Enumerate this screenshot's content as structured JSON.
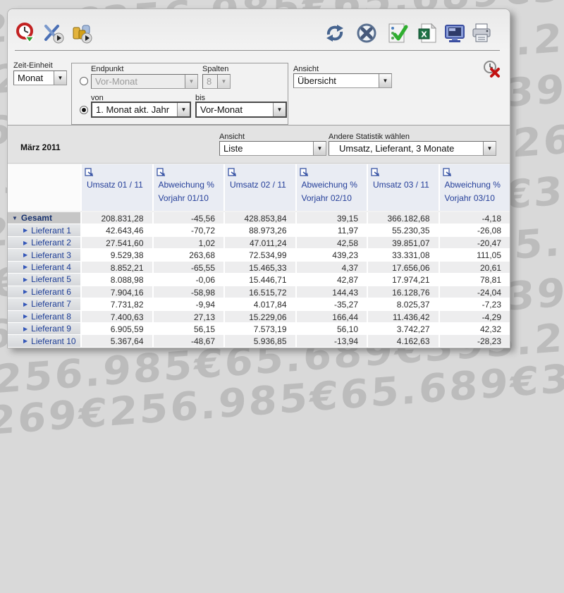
{
  "background": {
    "watermark_text": "395.269€256.985€65.689€"
  },
  "toolbar": {
    "left_icons": [
      {
        "name": "time-period-icon"
      },
      {
        "name": "analysis-tools-icon"
      },
      {
        "name": "data-stock-icon"
      }
    ],
    "right_icons": [
      {
        "name": "refresh-icon"
      },
      {
        "name": "cancel-icon"
      },
      {
        "name": "validate-list-icon"
      },
      {
        "name": "excel-export-icon"
      },
      {
        "name": "screen-view-icon"
      },
      {
        "name": "print-icon"
      }
    ]
  },
  "filter_panel": {
    "zeit_einheit": {
      "label": "Zeit-Einheit",
      "value": "Monat"
    },
    "endpunkt": {
      "label": "Endpunkt",
      "value": "Vor-Monat"
    },
    "spalten": {
      "label": "Spalten",
      "value": "8"
    },
    "von": {
      "label": "von",
      "value": "1. Monat akt. Jahr"
    },
    "bis": {
      "label": "bis",
      "value": "Vor-Monat"
    },
    "ansicht": {
      "label": "Ansicht",
      "value": "Übersicht"
    },
    "reset_icon": "clock-cancel-icon"
  },
  "status_row": {
    "period": "März 2011",
    "ansicht": {
      "label": "Ansicht",
      "value": "Liste"
    },
    "statistik": {
      "label": "Andere Statistik wählen",
      "value": "Umsatz, Lieferant, 3 Monate"
    }
  },
  "table": {
    "columns": [
      {
        "line1": "Umsatz 01 / 11",
        "line2": ""
      },
      {
        "line1": "Abweichung %",
        "line2": "Vorjahr 01/10"
      },
      {
        "line1": "Umsatz 02 / 11",
        "line2": ""
      },
      {
        "line1": "Abweichung %",
        "line2": "Vorjahr 02/10"
      },
      {
        "line1": "Umsatz 03 / 11",
        "line2": ""
      },
      {
        "line1": "Abweichung %",
        "line2": "Vorjahr 03/10"
      }
    ],
    "rows": [
      {
        "label": "Gesamt",
        "state": "expanded",
        "values": [
          "208.831,28",
          "-45,56",
          "428.853,84",
          "39,15",
          "366.182,68",
          "-4,18"
        ]
      },
      {
        "label": "Lieferant 1",
        "state": "collapsed",
        "values": [
          "42.643,46",
          "-70,72",
          "88.973,26",
          "11,97",
          "55.230,35",
          "-26,08"
        ]
      },
      {
        "label": "Lieferant 2",
        "state": "collapsed",
        "values": [
          "27.541,60",
          "1,02",
          "47.011,24",
          "42,58",
          "39.851,07",
          "-20,47"
        ]
      },
      {
        "label": "Lieferant 3",
        "state": "collapsed",
        "values": [
          "9.529,38",
          "263,68",
          "72.534,99",
          "439,23",
          "33.331,08",
          "111,05"
        ]
      },
      {
        "label": "Lieferant 4",
        "state": "collapsed",
        "values": [
          "8.852,21",
          "-65,55",
          "15.465,33",
          "4,37",
          "17.656,06",
          "20,61"
        ]
      },
      {
        "label": "Lieferant 5",
        "state": "collapsed",
        "values": [
          "8.088,98",
          "-0,06",
          "15.446,71",
          "42,87",
          "17.974,21",
          "78,81"
        ]
      },
      {
        "label": "Lieferant 6",
        "state": "collapsed",
        "values": [
          "7.904,16",
          "-58,98",
          "16.515,72",
          "144,43",
          "16.128,76",
          "-24,04"
        ]
      },
      {
        "label": "Lieferant 7",
        "state": "collapsed",
        "values": [
          "7.731,82",
          "-9,94",
          "4.017,84",
          "-35,27",
          "8.025,37",
          "-7,23"
        ]
      },
      {
        "label": "Lieferant 8",
        "state": "collapsed",
        "values": [
          "7.400,63",
          "27,13",
          "15.229,06",
          "166,44",
          "11.436,42",
          "-4,29"
        ]
      },
      {
        "label": "Lieferant 9",
        "state": "collapsed",
        "values": [
          "6.905,59",
          "56,15",
          "7.573,19",
          "56,10",
          "3.742,27",
          "42,32"
        ]
      },
      {
        "label": "Lieferant 10",
        "state": "collapsed",
        "values": [
          "5.367,64",
          "-48,67",
          "5.936,85",
          "-13,94",
          "4.162,63",
          "-28,23"
        ]
      }
    ]
  },
  "colors": {
    "header_text": "#26409a",
    "watermark": "#bcbcbc",
    "accent_red": "#c22121",
    "accent_green": "#2f9e2f"
  }
}
